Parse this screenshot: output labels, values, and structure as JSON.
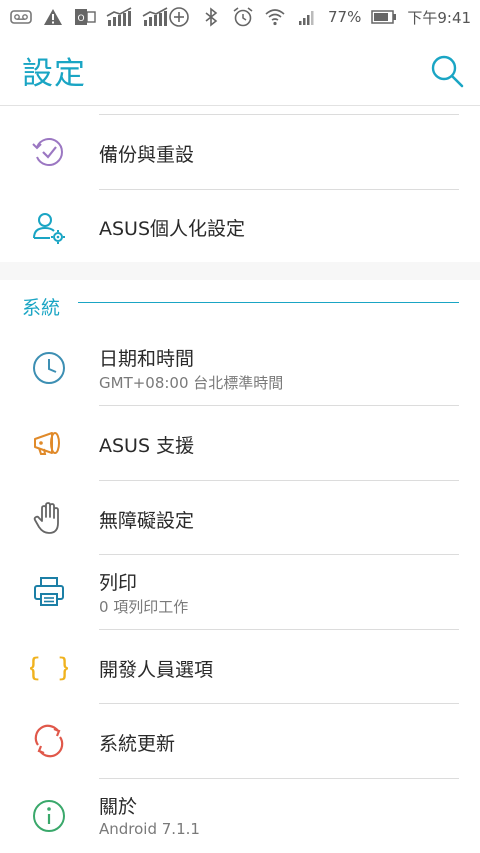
{
  "statusbar": {
    "battery_pct": "77%",
    "time": "下午9:41",
    "icons": [
      "voicemail-icon",
      "warning-icon",
      "outlook-icon",
      "signal-chart-icon",
      "signal-chart-icon",
      "data-saver-icon",
      "bluetooth-icon",
      "alarm-icon",
      "wifi-icon",
      "cell-signal-icon",
      "battery-icon"
    ]
  },
  "header": {
    "title": "設定",
    "search_icon": "search-icon"
  },
  "items_top": [
    {
      "id": "backup-reset",
      "label": "備份與重設",
      "icon": "backup-check-icon",
      "color": "#9b77c2"
    },
    {
      "id": "asus-personalize",
      "label": "ASUS個人化設定",
      "icon": "user-gear-icon",
      "color": "#1aa5c4"
    }
  ],
  "section": {
    "label": "系統"
  },
  "items_system": [
    {
      "id": "date-time",
      "label": "日期和時間",
      "sub": "GMT+08:00 台北標準時間",
      "icon": "clock-icon",
      "color": "#3d8fb3"
    },
    {
      "id": "asus-support",
      "label": "ASUS 支援",
      "icon": "megaphone-icon",
      "color": "#e08a2a"
    },
    {
      "id": "accessibility",
      "label": "無障礙設定",
      "icon": "hand-icon",
      "color": "#666666"
    },
    {
      "id": "printing",
      "label": "列印",
      "sub": "0 項列印工作",
      "icon": "printer-icon",
      "color": "#1c7fa6"
    },
    {
      "id": "developer",
      "label": "開發人員選項",
      "icon": "braces-icon",
      "color": "#f0b21e"
    },
    {
      "id": "system-update",
      "label": "系統更新",
      "icon": "refresh-icon",
      "color": "#e0584a"
    },
    {
      "id": "about",
      "label": "關於",
      "sub": "Android 7.1.1",
      "icon": "info-icon",
      "color": "#3aa86b"
    }
  ]
}
